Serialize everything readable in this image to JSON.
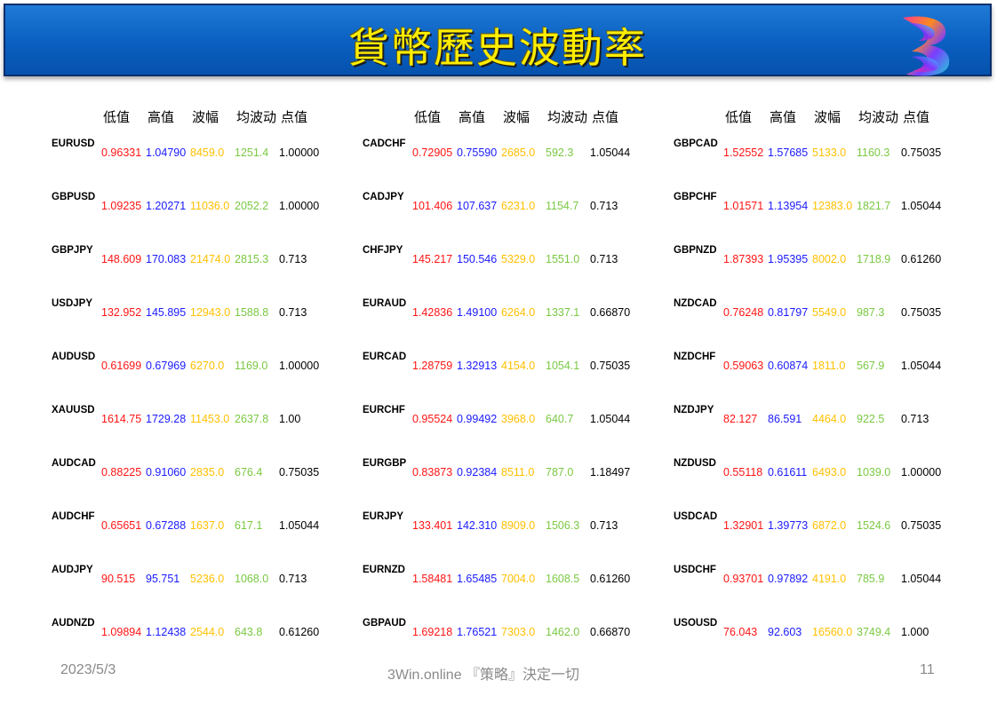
{
  "title": "貨幣歷史波動率",
  "headers": [
    "低值",
    "高值",
    "波幅",
    "均波动",
    "点值"
  ],
  "columns": [
    [
      {
        "symbol": "EURUSD",
        "low": "0.96331",
        "high": "1.04790",
        "range": "8459.0",
        "avg": "1251.4",
        "point": "1.00000"
      },
      {
        "symbol": "GBPUSD",
        "low": "1.09235",
        "high": "1.20271",
        "range": "11036.0",
        "avg": "2052.2",
        "point": "1.00000"
      },
      {
        "symbol": "GBPJPY",
        "low": "148.609",
        "high": "170.083",
        "range": "21474.0",
        "avg": "2815.3",
        "point": "0.713"
      },
      {
        "symbol": "USDJPY",
        "low": "132.952",
        "high": "145.895",
        "range": "12943.0",
        "avg": "1588.8",
        "point": "0.713"
      },
      {
        "symbol": "AUDUSD",
        "low": "0.61699",
        "high": "0.67969",
        "range": "6270.0",
        "avg": "1169.0",
        "point": "1.00000"
      },
      {
        "symbol": "XAUUSD",
        "low": "1614.75",
        "high": "1729.28",
        "range": "11453.0",
        "avg": "2637.8",
        "point": "1.00"
      },
      {
        "symbol": "AUDCAD",
        "low": "0.88225",
        "high": "0.91060",
        "range": "2835.0",
        "avg": "676.4",
        "point": "0.75035"
      },
      {
        "symbol": "AUDCHF",
        "low": "0.65651",
        "high": "0.67288",
        "range": "1637.0",
        "avg": "617.1",
        "point": "1.05044"
      },
      {
        "symbol": "AUDJPY",
        "low": "90.515",
        "high": "95.751",
        "range": "5236.0",
        "avg": "1068.0",
        "point": "0.713"
      },
      {
        "symbol": "AUDNZD",
        "low": "1.09894",
        "high": "1.12438",
        "range": "2544.0",
        "avg": "643.8",
        "point": "0.61260"
      }
    ],
    [
      {
        "symbol": "CADCHF",
        "low": "0.72905",
        "high": "0.75590",
        "range": "2685.0",
        "avg": "592.3",
        "point": "1.05044"
      },
      {
        "symbol": "CADJPY",
        "low": "101.406",
        "high": "107.637",
        "range": "6231.0",
        "avg": "1154.7",
        "point": "0.713"
      },
      {
        "symbol": "CHFJPY",
        "low": "145.217",
        "high": "150.546",
        "range": "5329.0",
        "avg": "1551.0",
        "point": "0.713"
      },
      {
        "symbol": "EURAUD",
        "low": "1.42836",
        "high": "1.49100",
        "range": "6264.0",
        "avg": "1337.1",
        "point": "0.66870"
      },
      {
        "symbol": "EURCAD",
        "low": "1.28759",
        "high": "1.32913",
        "range": "4154.0",
        "avg": "1054.1",
        "point": "0.75035"
      },
      {
        "symbol": "EURCHF",
        "low": "0.95524",
        "high": "0.99492",
        "range": "3968.0",
        "avg": "640.7",
        "point": "1.05044"
      },
      {
        "symbol": "EURGBP",
        "low": "0.83873",
        "high": "0.92384",
        "range": "8511.0",
        "avg": "787.0",
        "point": "1.18497"
      },
      {
        "symbol": "EURJPY",
        "low": "133.401",
        "high": "142.310",
        "range": "8909.0",
        "avg": "1506.3",
        "point": "0.713"
      },
      {
        "symbol": "EURNZD",
        "low": "1.58481",
        "high": "1.65485",
        "range": "7004.0",
        "avg": "1608.5",
        "point": "0.61260"
      },
      {
        "symbol": "GBPAUD",
        "low": "1.69218",
        "high": "1.76521",
        "range": "7303.0",
        "avg": "1462.0",
        "point": "0.66870"
      }
    ],
    [
      {
        "symbol": "GBPCAD",
        "low": "1.52552",
        "high": "1.57685",
        "range": "5133.0",
        "avg": "1160.3",
        "point": "0.75035"
      },
      {
        "symbol": "GBPCHF",
        "low": "1.01571",
        "high": "1.13954",
        "range": "12383.0",
        "avg": "1821.7",
        "point": "1.05044"
      },
      {
        "symbol": "GBPNZD",
        "low": "1.87393",
        "high": "1.95395",
        "range": "8002.0",
        "avg": "1718.9",
        "point": "0.61260"
      },
      {
        "symbol": "NZDCAD",
        "low": "0.76248",
        "high": "0.81797",
        "range": "5549.0",
        "avg": "987.3",
        "point": "0.75035"
      },
      {
        "symbol": "NZDCHF",
        "low": "0.59063",
        "high": "0.60874",
        "range": "1811.0",
        "avg": "567.9",
        "point": "1.05044"
      },
      {
        "symbol": "NZDJPY",
        "low": "82.127",
        "high": "86.591",
        "range": "4464.0",
        "avg": "922.5",
        "point": "0.713"
      },
      {
        "symbol": "NZDUSD",
        "low": "0.55118",
        "high": "0.61611",
        "range": "6493.0",
        "avg": "1039.0",
        "point": "1.00000"
      },
      {
        "symbol": "USDCAD",
        "low": "1.32901",
        "high": "1.39773",
        "range": "6872.0",
        "avg": "1524.6",
        "point": "0.75035"
      },
      {
        "symbol": "USDCHF",
        "low": "0.93701",
        "high": "0.97892",
        "range": "4191.0",
        "avg": "785.9",
        "point": "1.05044"
      },
      {
        "symbol": "USOUSD",
        "low": "76.043",
        "high": "92.603",
        "range": "16560.0",
        "avg": "3749.4",
        "point": "1.000"
      }
    ]
  ],
  "footer": {
    "date": "2023/5/3",
    "center": "3Win.online 『策略』決定一切",
    "page": "11"
  },
  "colors": {
    "low": "#ff1414",
    "high": "#1a1aff",
    "range": "#ffc000",
    "avg": "#7ac943",
    "point": "#000000"
  }
}
